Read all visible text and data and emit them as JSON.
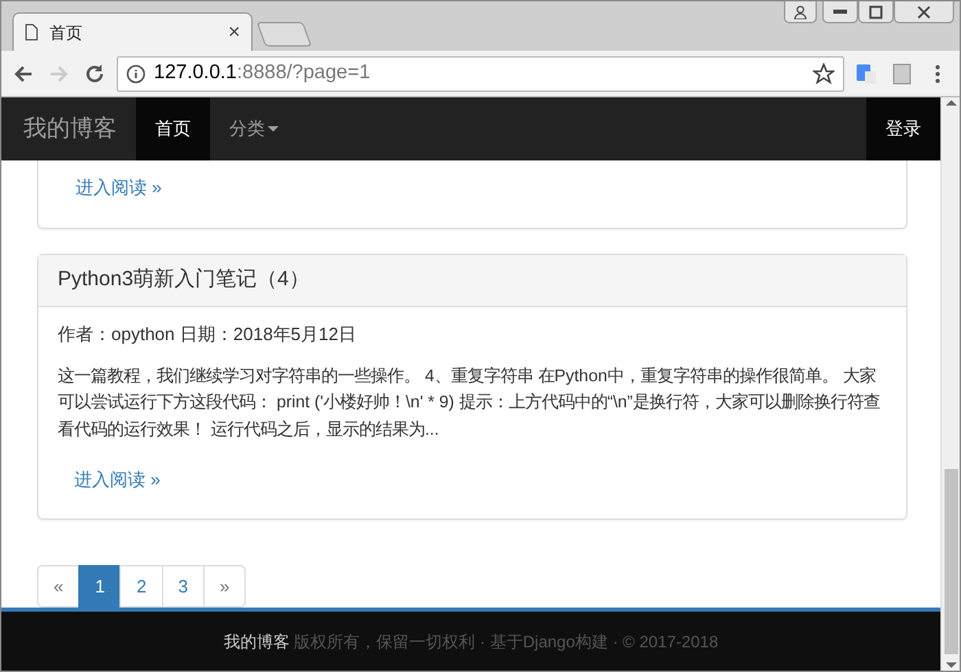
{
  "browser": {
    "tab_title": "首页",
    "tab_close": "×",
    "url_host": "127.0.0.1",
    "url_rest": ":8888/?page=1"
  },
  "navbar": {
    "brand": "我的博客",
    "items": [
      {
        "label": "首页",
        "selected": true
      },
      {
        "label": "分类",
        "selected": false,
        "kind": "dropdown"
      }
    ],
    "login": "登录"
  },
  "posts": [
    {
      "read_more": "进入阅读 »"
    },
    {
      "title": "Python3萌新入门笔记（4）",
      "meta": "作者：opython 日期：2018年5月12日",
      "excerpt": "这一篇教程，我们继续学习对字符串的一些操作。 4、重复字符串 在Python中，重复字符串的操作很简单。 大家可以尝试运行下方这段代码： print ('小楼好帅！\\n' * 9) 提示：上方代码中的“\\n”是换行符，大家可以删除换行符查看代码的运行效果！ 运行代码之后，显示的结果为...",
      "read_more": "进入阅读 »"
    }
  ],
  "pagination": [
    {
      "label": "«",
      "selected": false
    },
    {
      "label": "1",
      "selected": true
    },
    {
      "label": "2",
      "selected": false
    },
    {
      "label": "3",
      "selected": false
    },
    {
      "label": "»",
      "selected": false
    }
  ],
  "footer": {
    "text": "**我的博客** 版权所有，保留一切权利 · 基于Django构建 · © 2017-2018"
  }
}
